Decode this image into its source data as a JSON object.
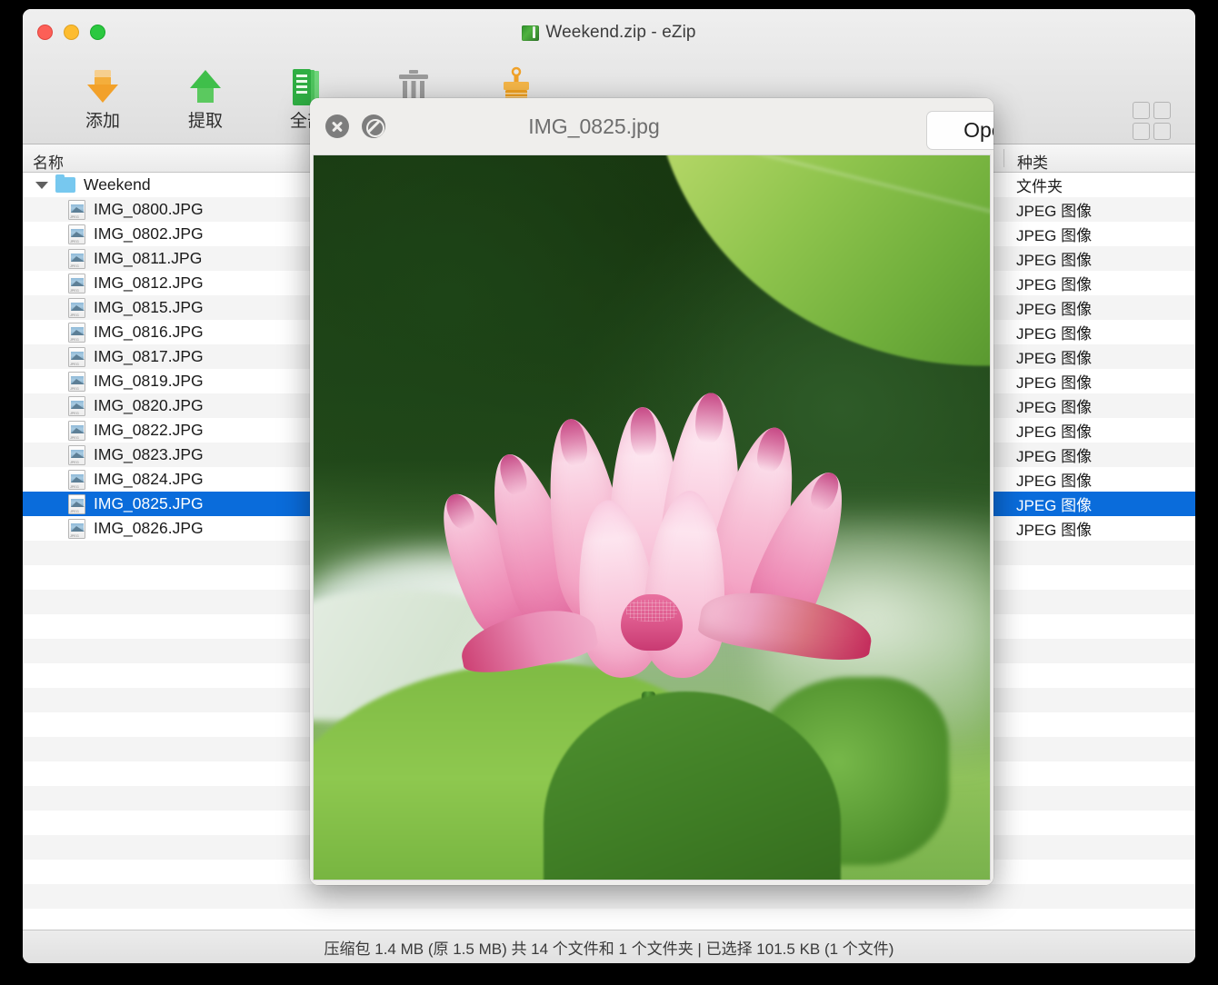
{
  "window": {
    "title": "Weekend.zip - eZip",
    "title_icon": "archive-icon",
    "traffic_lights": [
      "close",
      "minimize",
      "zoom"
    ]
  },
  "toolbar": {
    "items": [
      {
        "label": "添加",
        "icon": "arrow-down-icon",
        "name": "add"
      },
      {
        "label": "提取",
        "icon": "arrow-up-icon",
        "name": "extract"
      },
      {
        "label": "全部",
        "icon": "documents-icon",
        "name": "extract-all"
      },
      {
        "label": "",
        "icon": "trash-icon",
        "name": "delete"
      },
      {
        "label": "",
        "icon": "brush-icon",
        "name": "clean"
      }
    ],
    "right_icons": [
      {
        "icon": "grid-view-icon",
        "name": "grid-view"
      },
      {
        "icon": "image-icon",
        "name": "preview-image"
      },
      {
        "icon": "search-icon",
        "name": "search"
      }
    ],
    "colors": {
      "add_arrow": "#f4a62a",
      "extract_arrow": "#3fbf4a",
      "documents": "#35b14a",
      "trash": "#9a9a9a",
      "brush": "#f0a128"
    }
  },
  "columns": {
    "name": "名称",
    "kind": "种类"
  },
  "files": [
    {
      "name": "Weekend",
      "kind": "文件夹",
      "type": "folder",
      "indent": 0,
      "selected": false
    },
    {
      "name": "IMG_0800.JPG",
      "kind": "JPEG 图像",
      "type": "jpeg",
      "indent": 1,
      "selected": false
    },
    {
      "name": "IMG_0802.JPG",
      "kind": "JPEG 图像",
      "type": "jpeg",
      "indent": 1,
      "selected": false
    },
    {
      "name": "IMG_0811.JPG",
      "kind": "JPEG 图像",
      "type": "jpeg",
      "indent": 1,
      "selected": false
    },
    {
      "name": "IMG_0812.JPG",
      "kind": "JPEG 图像",
      "type": "jpeg",
      "indent": 1,
      "selected": false
    },
    {
      "name": "IMG_0815.JPG",
      "kind": "JPEG 图像",
      "type": "jpeg",
      "indent": 1,
      "selected": false
    },
    {
      "name": "IMG_0816.JPG",
      "kind": "JPEG 图像",
      "type": "jpeg",
      "indent": 1,
      "selected": false
    },
    {
      "name": "IMG_0817.JPG",
      "kind": "JPEG 图像",
      "type": "jpeg",
      "indent": 1,
      "selected": false
    },
    {
      "name": "IMG_0819.JPG",
      "kind": "JPEG 图像",
      "type": "jpeg",
      "indent": 1,
      "selected": false
    },
    {
      "name": "IMG_0820.JPG",
      "kind": "JPEG 图像",
      "type": "jpeg",
      "indent": 1,
      "selected": false
    },
    {
      "name": "IMG_0822.JPG",
      "kind": "JPEG 图像",
      "type": "jpeg",
      "indent": 1,
      "selected": false
    },
    {
      "name": "IMG_0823.JPG",
      "kind": "JPEG 图像",
      "type": "jpeg",
      "indent": 1,
      "selected": false
    },
    {
      "name": "IMG_0824.JPG",
      "kind": "JPEG 图像",
      "type": "jpeg",
      "indent": 1,
      "selected": false
    },
    {
      "name": "IMG_0825.JPG",
      "kind": "JPEG 图像",
      "type": "jpeg",
      "indent": 1,
      "selected": true
    },
    {
      "name": "IMG_0826.JPG",
      "kind": "JPEG 图像",
      "type": "jpeg",
      "indent": 1,
      "selected": false
    }
  ],
  "selection_color": "#0a6cdb",
  "status_bar": {
    "text": "压缩包 1.4 MB (原 1.5 MB) 共 14 个文件和 1 个文件夹  |  已选择 101.5 KB (1 个文件)"
  },
  "quicklook": {
    "filename": "IMG_0825.jpg",
    "open_button": "Open with Preview",
    "close_icon": "close-circle-icon",
    "fullscreen_icon": "no-entry-circle-icon",
    "share_icon": "share-icon",
    "photo": {
      "subject": "pink lotus flower",
      "background": "blurred dark green foliage with bright green leaf top-right and large green lotus leaves at bottom"
    }
  }
}
